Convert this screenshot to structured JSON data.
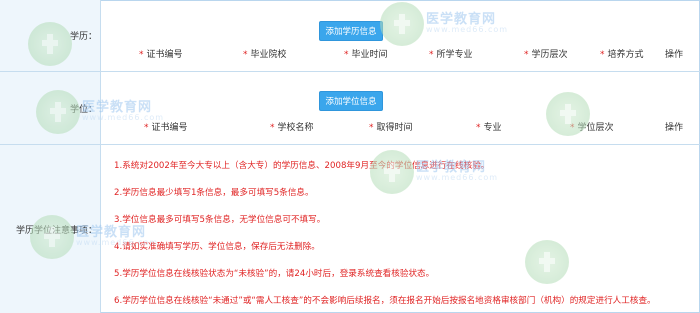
{
  "education": {
    "label": "学历：",
    "add_button": "添加学历信息",
    "columns": [
      "证书编号",
      "毕业院校",
      "毕业时间",
      "所学专业",
      "学历层次",
      "培养方式"
    ],
    "action_col": "操作"
  },
  "degree": {
    "label": "学位：",
    "add_button": "添加学位信息",
    "columns": [
      "证书编号",
      "学校名称",
      "取得时间",
      "专业",
      "学位层次"
    ],
    "action_col": "操作"
  },
  "notes": {
    "label": "学历学位注意事项：",
    "items": [
      "1.系统对2002年至今大专以上（含大专）的学历信息、2008年9月至今的学位信息进行在线核验。",
      "2.学历信息最少填写1条信息，最多可填写5条信息。",
      "3.学位信息最多可填写5条信息，无学位信息可不填写。",
      "4.请如实准确填写学历、学位信息，保存后无法删除。",
      "5.学历学位信息在线核验状态为“未核验”的，请24小时后，登录系统查看核验状态。",
      "6.学历学位信息在线核验“未通过”或“需人工核查”的不会影响后续报名，须在报名开始后按报名地资格审核部门（机构）的规定进行人工核查。"
    ]
  },
  "required_mark": "*",
  "watermark": {
    "name": "医学教育网",
    "url": "www.med66.com"
  },
  "colors": {
    "accent": "#3aa6ec",
    "warning_text": "#e02424",
    "label_bg": "#eef6fc",
    "border": "#c6ddef"
  }
}
